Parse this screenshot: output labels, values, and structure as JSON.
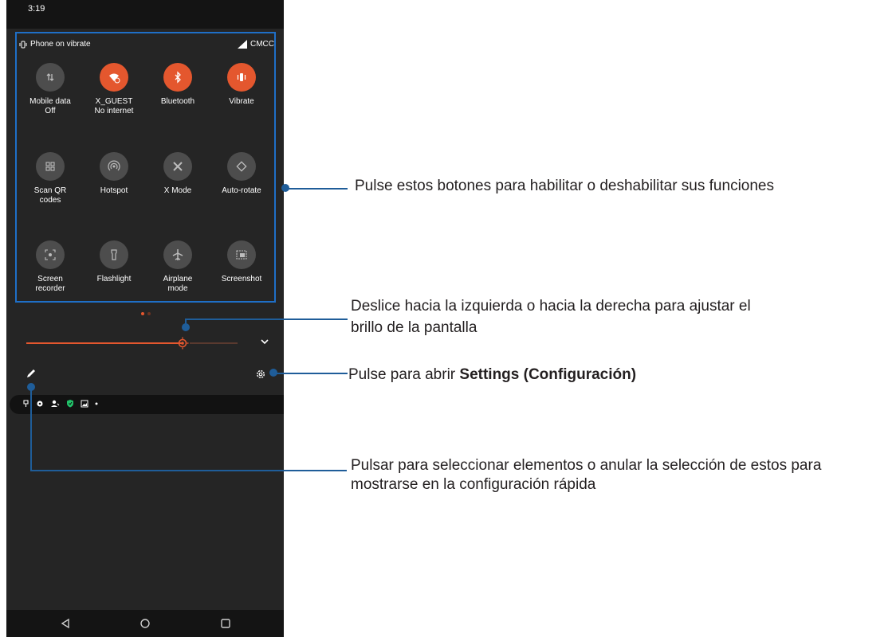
{
  "status_bar": {
    "time": "3:19"
  },
  "quick_settings": {
    "header_left": "Phone on vibrate",
    "header_right": "CMCC",
    "tiles": [
      {
        "label": "Mobile data",
        "sub": "Off",
        "state": "off",
        "icon": "mobile-data-icon"
      },
      {
        "label": "X_GUEST",
        "sub": "No internet",
        "state": "on",
        "icon": "wifi-icon"
      },
      {
        "label": "Bluetooth",
        "sub": "",
        "state": "on",
        "icon": "bluetooth-icon"
      },
      {
        "label": "Vibrate",
        "sub": "",
        "state": "on",
        "icon": "vibrate-icon"
      },
      {
        "label": "Scan QR",
        "sub": "codes",
        "state": "off",
        "icon": "qr-icon"
      },
      {
        "label": "Hotspot",
        "sub": "",
        "state": "off",
        "icon": "hotspot-icon"
      },
      {
        "label": "X Mode",
        "sub": "",
        "state": "off",
        "icon": "x-mode-icon"
      },
      {
        "label": "Auto-rotate",
        "sub": "",
        "state": "off",
        "icon": "auto-rotate-icon"
      },
      {
        "label": "Screen",
        "sub": "recorder",
        "state": "off",
        "icon": "screen-recorder-icon"
      },
      {
        "label": "Flashlight",
        "sub": "",
        "state": "off",
        "icon": "flashlight-icon"
      },
      {
        "label": "Airplane",
        "sub": "mode",
        "state": "off",
        "icon": "airplane-icon"
      },
      {
        "label": "Screenshot",
        "sub": "",
        "state": "off",
        "icon": "screenshot-icon"
      }
    ],
    "accent_color": "#e4572e",
    "page_dots": 2
  },
  "brightness": {
    "level": 0.73
  },
  "callouts": {
    "tiles": "Pulse estos botones para habilitar o deshabilitar sus funciones",
    "brightness_line1": "Deslice hacia la izquierda o hacia la derecha para ajustar el",
    "brightness_line2": "brillo de la pantalla",
    "settings_prefix": "Pulse para abrir ",
    "settings_bold": "Settings (Configuración)",
    "edit_line1": "Pulsar para seleccionar elementos o anular la selección de estos para",
    "edit_line2": "mostrarse en la configuración rápida",
    "line_color": "#1f5d99"
  }
}
